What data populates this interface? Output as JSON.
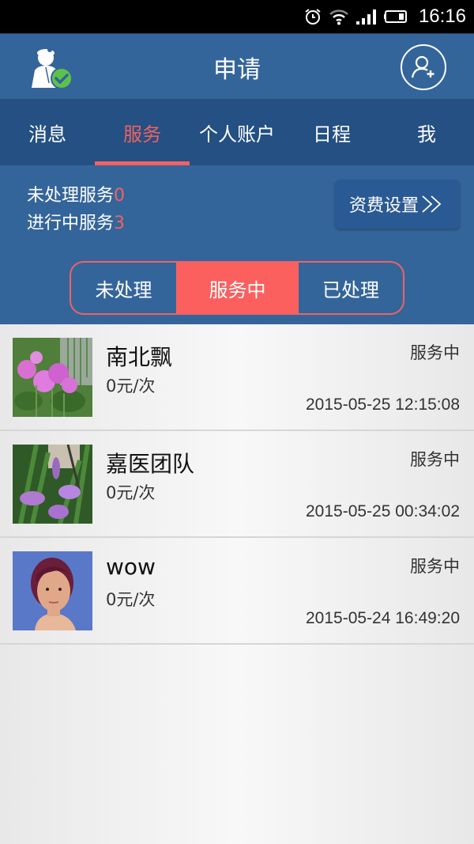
{
  "status_bar": {
    "time": "16:16",
    "icons": [
      "alarm-icon",
      "wifi-icon",
      "signal-icon",
      "battery-icon"
    ]
  },
  "header": {
    "title": "申请",
    "left_icon": "doctor-verified-icon",
    "right_icon": "add-user-icon"
  },
  "tabs": [
    {
      "label": "消息",
      "active": false
    },
    {
      "label": "服务",
      "active": true
    },
    {
      "label": "个人账户",
      "active": false
    },
    {
      "label": "日程",
      "active": false
    },
    {
      "label": "我",
      "active": false
    }
  ],
  "summary": {
    "pending_label": "未处理服务",
    "pending_count": "0",
    "in_progress_label": "进行中服务",
    "in_progress_count": "3",
    "fee_button_label": "资费设置",
    "fee_button_icon": "double-chevron-right-icon"
  },
  "segments": [
    {
      "label": "未处理",
      "active": false
    },
    {
      "label": "服务中",
      "active": true
    },
    {
      "label": "已处理",
      "active": false
    }
  ],
  "items": [
    {
      "name": "南北飘",
      "price": "0元/次",
      "status": "服务中",
      "time": "2015-05-25 12:15:08",
      "avatar": "pink-flowers-photo"
    },
    {
      "name": "嘉医团队",
      "price": "0元/次",
      "status": "服务中",
      "time": "2015-05-25 00:34:02",
      "avatar": "purple-orchid-photo"
    },
    {
      "name": "wow",
      "price": "0元/次",
      "status": "服务中",
      "time": "2015-05-24 16:49:20",
      "avatar": "portrait-photo"
    }
  ],
  "colors": {
    "primary": "#34659a",
    "tab_bar": "#245083",
    "accent": "#f06262"
  }
}
